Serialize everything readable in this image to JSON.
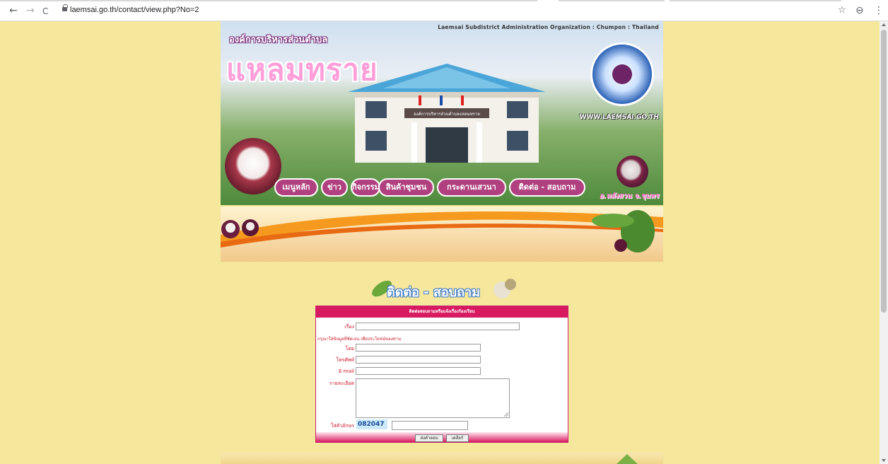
{
  "browser": {
    "url": "laemsai.go.th/contact/view.php?No=2",
    "back_icon": "←",
    "forward_icon": "→",
    "reload_icon": "C",
    "star_icon": "☆",
    "account_icon": "⊖",
    "menu_icon": "⋮"
  },
  "banner": {
    "tagline": "Laemsai Subdistrict  Administration Organization : Chumpon : Thailand",
    "org_name": "องค์การบริหารส่วนตำบล",
    "big_name": "แหลมทราย",
    "website": "WWW.LAEMSAI.GO.TH",
    "credit": "อ.หลังสวน จ.ชุมพร",
    "menu": [
      "เมนูหลัก",
      "ข่าว",
      "กิจกรรม",
      "สินค้าชุมชน",
      "กระดานเสวนา",
      "ติดต่อ - สอบถาม"
    ]
  },
  "section_title": "ติดต่อ - สอบถาม",
  "form": {
    "header": "ติดต่อสอบถามหรือแจ้งเรื่องร้องเรียน",
    "subject_label": "เรื่อง",
    "hint": "กรุณาใส่ข้อมูลที่ชัดเจน เพื่อประโยชน์ของท่าน",
    "by_label": "โดย",
    "phone_label": "โทรศัพท์",
    "email_label": "E-mail",
    "detail_label": "รายละเอียด",
    "captcha_label": "ใส่ตัวอักษร",
    "captcha_code": "082047",
    "submit_label": "ส่งคำตอบ",
    "clear_label": "เคลียร์"
  }
}
